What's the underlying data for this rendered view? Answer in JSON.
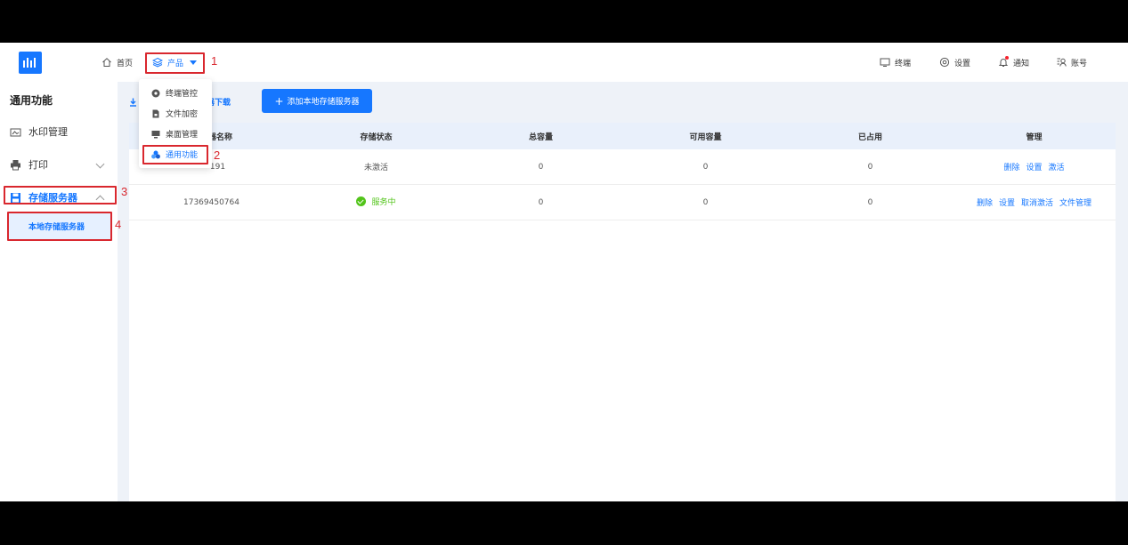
{
  "nav": {
    "home": "首页",
    "product": "产品",
    "terminal": "终端",
    "settings": "设置",
    "notify": "通知",
    "account": "账号"
  },
  "sidebar": {
    "title": "通用功能",
    "items": [
      {
        "label": "水印管理",
        "icon": "watermark-icon"
      },
      {
        "label": "打印",
        "icon": "printer-icon"
      },
      {
        "label": "存储服务器",
        "icon": "save-icon"
      }
    ],
    "sub_item": "本地存储服务器"
  },
  "dropdown": {
    "items": [
      {
        "label": "终端管控",
        "icon": "terminal-control-icon"
      },
      {
        "label": "文件加密",
        "icon": "file-lock-icon"
      },
      {
        "label": "桌面管理",
        "icon": "desktop-icon"
      },
      {
        "label": "通用功能",
        "icon": "general-icon"
      }
    ]
  },
  "toolbar": {
    "download_label": "器下载",
    "add_label": "添加本地存储服务器"
  },
  "table": {
    "headers": [
      "器名称",
      "存储状态",
      "总容量",
      "可用容量",
      "已占用",
      "管理"
    ],
    "rows": [
      {
        "name": "191",
        "status": "未激活",
        "total": "0",
        "free": "0",
        "used": "0",
        "actions": [
          "删除",
          "设置",
          "激活"
        ]
      },
      {
        "name": "17369450764",
        "status": "服务中",
        "total": "0",
        "free": "0",
        "used": "0",
        "actions": [
          "删除",
          "设置",
          "取消激活",
          "文件管理"
        ]
      }
    ]
  },
  "annotations": [
    "1",
    "2",
    "3",
    "4"
  ],
  "colors": {
    "accent": "#1677ff",
    "annotation": "#d9272e",
    "success": "#52c41a"
  }
}
